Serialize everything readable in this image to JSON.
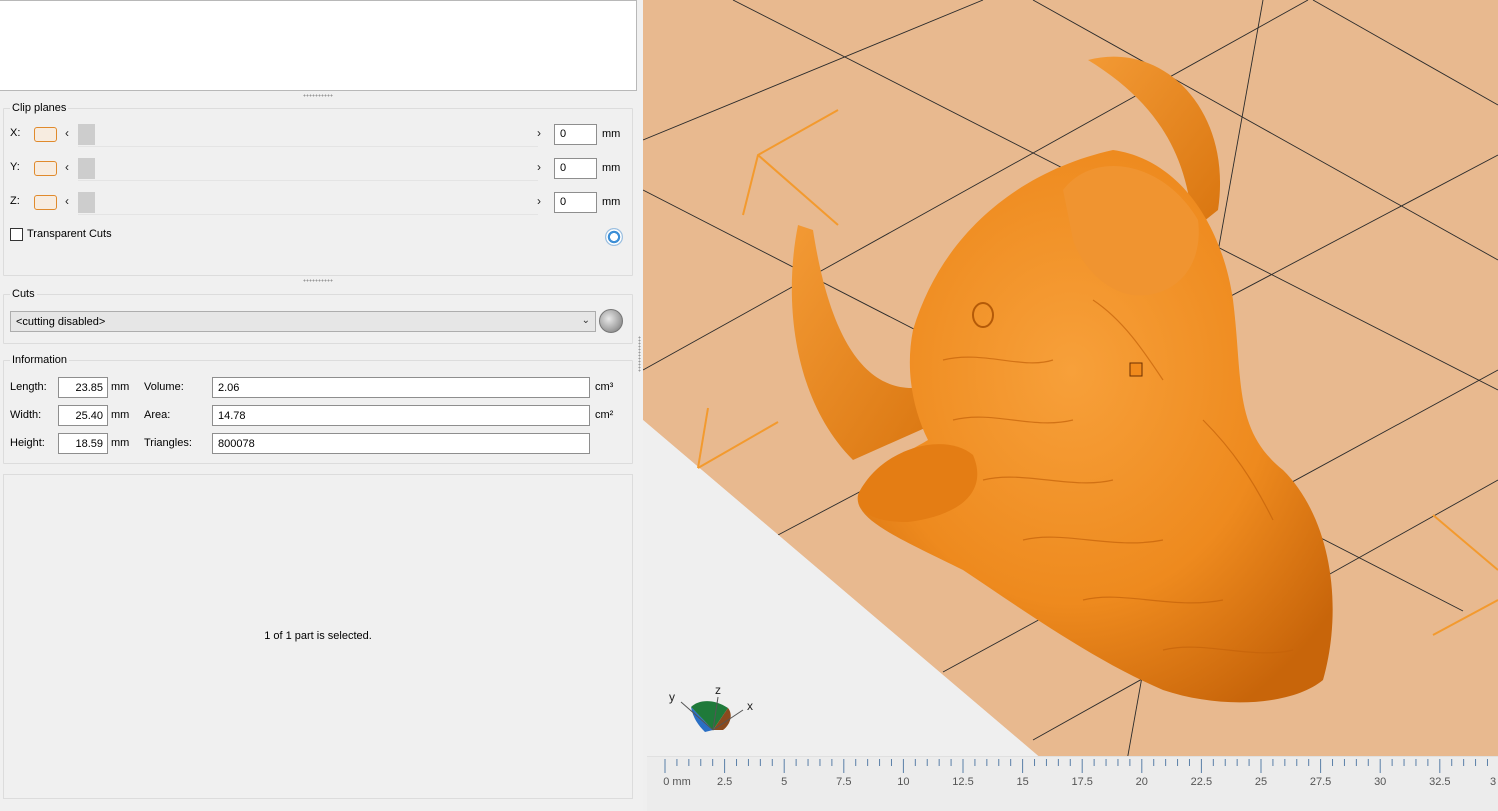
{
  "clip_planes": {
    "title": "Clip planes",
    "rows": [
      {
        "axis": "X:",
        "value": "0",
        "unit": "mm"
      },
      {
        "axis": "Y:",
        "value": "0",
        "unit": "mm"
      },
      {
        "axis": "Z:",
        "value": "0",
        "unit": "mm"
      }
    ],
    "arrow_left": "‹",
    "arrow_right": "›",
    "transparent_cuts_label": "Transparent Cuts",
    "transparent_cuts_checked": false
  },
  "cuts": {
    "title": "Cuts",
    "selected": "<cutting disabled>"
  },
  "information": {
    "title": "Information",
    "length_label": "Length:",
    "length_value": "23.85",
    "length_unit": "mm",
    "width_label": "Width:",
    "width_value": "25.40",
    "width_unit": "mm",
    "height_label": "Height:",
    "height_value": "18.59",
    "height_unit": "mm",
    "volume_label": "Volume:",
    "volume_value": "2.06",
    "volume_unit": "cm³",
    "area_label": "Area:",
    "area_value": "14.78",
    "area_unit": "cm²",
    "triangles_label": "Triangles:",
    "triangles_value": "800078"
  },
  "status": {
    "selection_text": "1 of 1 part is selected."
  },
  "viewport": {
    "axes": {
      "y": "y",
      "z": "z",
      "x": "x"
    },
    "ruler_labels": [
      "0 mm",
      "2.5",
      "5",
      "7.5",
      "10",
      "12.5",
      "15",
      "17.5",
      "20",
      "22.5",
      "25",
      "27.5",
      "30",
      "32.5",
      "3"
    ],
    "colors": {
      "model": "#f08a1c",
      "build_plate": "#e8b98f",
      "outline": "#f39a2e",
      "grid_line": "#2b2b2b"
    }
  }
}
